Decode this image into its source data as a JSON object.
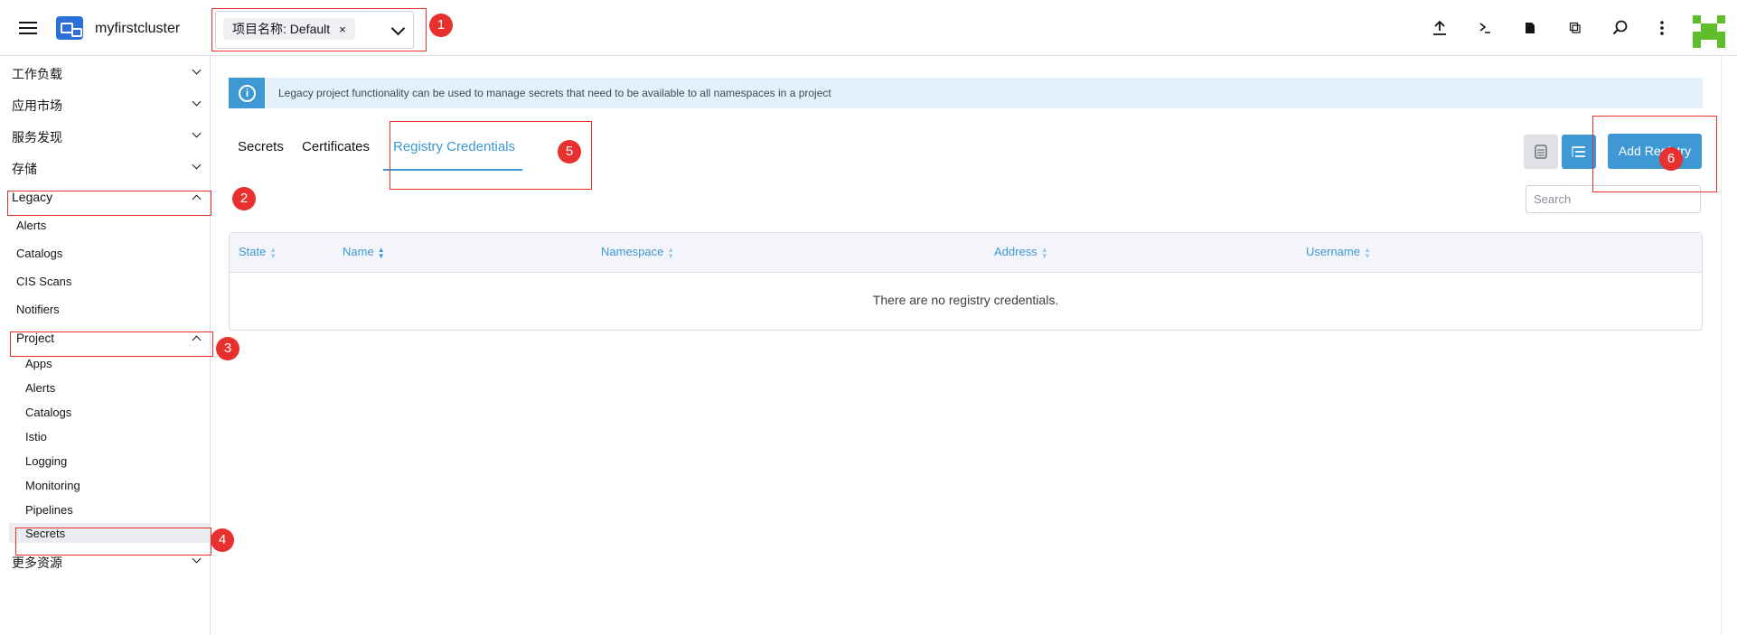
{
  "header": {
    "cluster_name": "myfirstcluster",
    "namespace_filter": {
      "chip_label": "项目名称: Default",
      "chip_remove": "×"
    }
  },
  "header_icons": [
    "upload-icon",
    "terminal-icon",
    "file-icon",
    "copy-icon",
    "search-icon",
    "more-vertical-icon"
  ],
  "sidebar": {
    "groups": [
      {
        "label": "工作负载"
      },
      {
        "label": "应用市场"
      },
      {
        "label": "服务发现"
      },
      {
        "label": "存储"
      },
      {
        "label": "Legacy"
      },
      {
        "label": "更多资源"
      }
    ],
    "legacy_items": [
      "Alerts",
      "Catalogs",
      "CIS Scans",
      "Notifiers"
    ],
    "project_label": "Project",
    "project_items": [
      "Apps",
      "Alerts",
      "Catalogs",
      "Istio",
      "Logging",
      "Monitoring",
      "Pipelines",
      "Secrets"
    ]
  },
  "banner": {
    "text": "Legacy project functionality can be used to manage secrets that need to be available to all namespaces in a project"
  },
  "tabs": [
    "Secrets",
    "Certificates",
    "Registry Credentials"
  ],
  "active_tab": "Registry Credentials",
  "toolbar": {
    "add_label": "Add Registry"
  },
  "search": {
    "placeholder": "Search",
    "value": ""
  },
  "table": {
    "columns": [
      "State",
      "Name",
      "Namespace",
      "Address",
      "Username"
    ],
    "empty_message": "There are no registry credentials."
  },
  "annotations": [
    "1",
    "2",
    "3",
    "4",
    "5",
    "6"
  ],
  "colors": {
    "accent": "#3d98d3",
    "annotation_red": "#e8312f",
    "banner_bg": "#e4f0fb",
    "cluster_logo": "#2d6fd9",
    "avatar_green": "#5fbd2c"
  }
}
